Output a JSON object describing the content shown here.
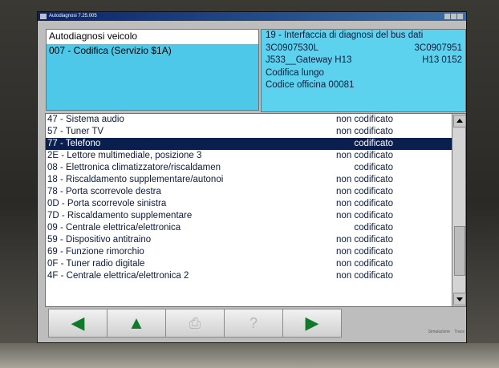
{
  "window": {
    "title": "Autodiagnosi 7.25.005"
  },
  "header": {
    "left": {
      "title": "Autodiagnosi veicolo",
      "selected_module": "007 - Codifica (Servizio $1A)"
    },
    "right": {
      "line1": "19 - Interfaccia di diagnosi del bus dati",
      "line2_left": "3C0907530L",
      "line2_right": "3C0907951",
      "line3_left": "J533__Gateway  H13",
      "line3_right": "H13  0152",
      "line4": "Codifica lungo",
      "line5": "Codice officina 00081"
    }
  },
  "list": {
    "selected_index": 2,
    "rows": [
      {
        "name": "47 - Sistema audio",
        "status": "non codificato"
      },
      {
        "name": "57 - Tuner TV",
        "status": "non codificato"
      },
      {
        "name": "77 - Telefono",
        "status": "codificato"
      },
      {
        "name": "2E - Lettore multimediale, posizione 3",
        "status": "non codificato"
      },
      {
        "name": "08 - Elettronica climatizzatore/riscaldamen",
        "status": "codificato"
      },
      {
        "name": "18 - Riscaldamento supplementare/autonoi",
        "status": "non codificato"
      },
      {
        "name": "78 - Porta scorrevole destra",
        "status": "non codificato"
      },
      {
        "name": "0D - Porta scorrevole sinistra",
        "status": "non codificato"
      },
      {
        "name": "7D - Riscaldamento supplementare",
        "status": "non codificato"
      },
      {
        "name": "09 - Centrale elettrica/elettronica",
        "status": "codificato"
      },
      {
        "name": "59 - Dispositivo antitraino",
        "status": "non codificato"
      },
      {
        "name": "69 - Funzione rimorchio",
        "status": "non codificato"
      },
      {
        "name": "0F - Tuner radio digitale",
        "status": "non codificato"
      },
      {
        "name": "4F - Centrale elettrica/elettronica 2",
        "status": "non codificato"
      }
    ]
  },
  "toolbar": {
    "back_icon": "left-arrow-icon",
    "up_icon": "up-arrow-icon",
    "print_icon": "printer-icon",
    "help_icon": "help-icon",
    "forward_icon": "right-arrow-icon",
    "print_glyph": "⎙",
    "help_glyph": "?"
  },
  "status": {
    "mode1": "Simulazione",
    "mode2": "Trace"
  },
  "colors": {
    "selection": "#0b1f4f",
    "panel_cyan": "#5dd2ee",
    "arrow_green": "#0e7a2a"
  }
}
